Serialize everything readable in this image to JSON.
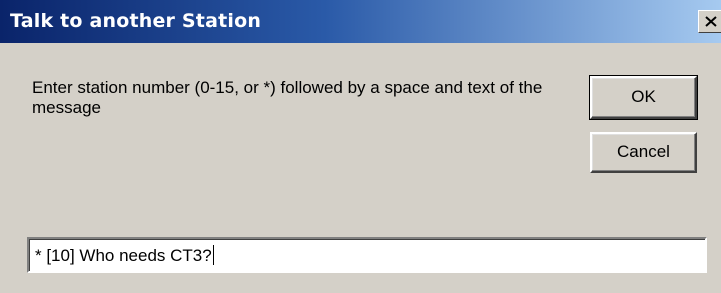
{
  "window": {
    "title": "Talk to another Station",
    "close_icon": "close-icon"
  },
  "prompt": {
    "text": "Enter station number (0-15, or *) followed by a space and text of the message"
  },
  "buttons": {
    "ok_label": "OK",
    "cancel_label": "Cancel"
  },
  "message_input": {
    "value": "* [10] Who needs CT3?"
  },
  "colors": {
    "titlebar_start": "#0a246a",
    "titlebar_end": "#a6caf0",
    "dialog_face": "#d4d0c8"
  }
}
